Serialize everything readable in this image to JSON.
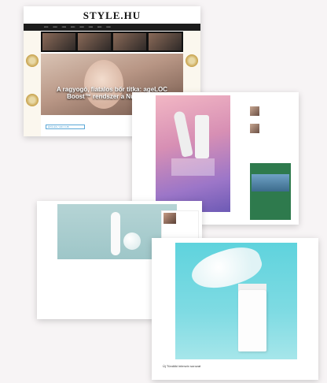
{
  "card1": {
    "logo": "STYLE.HU",
    "hero_title": "A ragyogó, fiatalos bőr titka: ageLOC Boost™ rendszer a Nu Skintől",
    "tag": "ÉPÜLÉS / ARC FJB"
  },
  "card4": {
    "footer": "Új Tündöki intenzív sorozat"
  }
}
